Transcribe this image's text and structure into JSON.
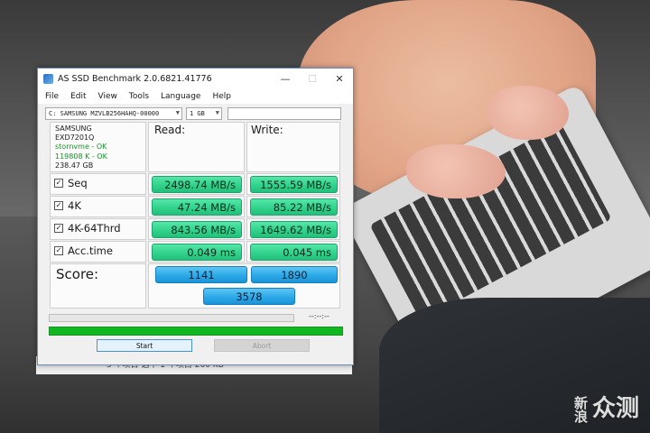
{
  "window": {
    "title": "AS SSD Benchmark 2.0.6821.41776",
    "minimize_glyph": "—",
    "maximize_glyph": "☐",
    "close_glyph": "✕"
  },
  "menu": [
    "File",
    "Edit",
    "View",
    "Tools",
    "Language",
    "Help"
  ],
  "toolbar": {
    "drive_selected": "C: SAMSUNG MZVLB256HAHQ-00000",
    "size_selected": "1 GB"
  },
  "drive_info": {
    "brand": "SAMSUNG",
    "firmware": "EXD7201Q",
    "driver": "stornvme - OK",
    "alignment": "119808 K - OK",
    "capacity": "238.47 GB"
  },
  "headers": {
    "read": "Read:",
    "write": "Write:"
  },
  "rows": [
    {
      "label": "Seq",
      "checked": true,
      "read": "2498.74 MB/s",
      "write": "1555.59 MB/s"
    },
    {
      "label": "4K",
      "checked": true,
      "read": "47.24 MB/s",
      "write": "85.22 MB/s"
    },
    {
      "label": "4K-64Thrd",
      "checked": true,
      "read": "843.56 MB/s",
      "write": "1649.62 MB/s"
    },
    {
      "label": "Acc.time",
      "checked": true,
      "read": "0.049 ms",
      "write": "0.045 ms"
    }
  ],
  "score": {
    "label": "Score:",
    "read": "1141",
    "write": "1890",
    "total": "3578"
  },
  "progress": {
    "elapsed": "--:--:--",
    "bottom_fill": 1.0
  },
  "buttons": {
    "start": "Start",
    "abort": "Abort"
  },
  "background": {
    "doc_text": "5 个项目    选中 1 个项目  260 KB",
    "watermark_small": "新浪",
    "watermark_big": "众测"
  },
  "colors": {
    "result_green": "#2fd18a",
    "score_blue": "#2aa6e6",
    "progress_green": "#10b820"
  }
}
